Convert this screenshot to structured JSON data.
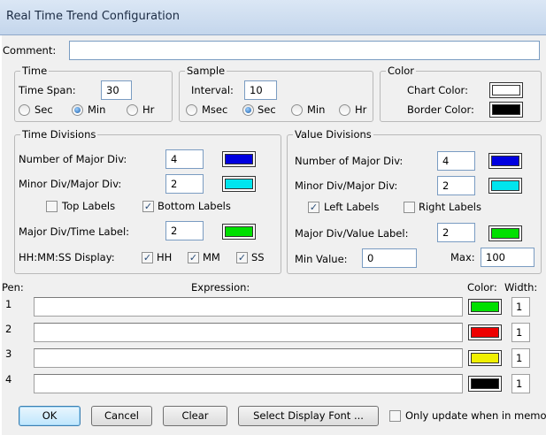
{
  "window": {
    "title": "Real Time Trend Configuration"
  },
  "comment": {
    "label": "Comment:",
    "value": ""
  },
  "time": {
    "legend": "Time",
    "span_label": "Time Span:",
    "span_value": "30",
    "units": [
      {
        "label": "Sec",
        "selected": false
      },
      {
        "label": "Min",
        "selected": true
      },
      {
        "label": "Hr",
        "selected": false
      }
    ]
  },
  "sample": {
    "legend": "Sample",
    "interval_label": "Interval:",
    "interval_value": "10",
    "units": [
      {
        "label": "Msec",
        "selected": false
      },
      {
        "label": "Sec",
        "selected": true
      },
      {
        "label": "Min",
        "selected": false
      },
      {
        "label": "Hr",
        "selected": false
      }
    ]
  },
  "color": {
    "legend": "Color",
    "chart_label": "Chart Color:",
    "chart_color": "#ffffff",
    "border_label": "Border Color:",
    "border_color": "#000000"
  },
  "time_div": {
    "legend": "Time Divisions",
    "major_label": "Number of Major Div:",
    "major_value": "4",
    "major_color": "#0000e0",
    "minor_label": "Minor Div/Major Div:",
    "minor_value": "2",
    "minor_color": "#00e5ee",
    "top_labels": "Top Labels",
    "top_checked": false,
    "bottom_labels": "Bottom Labels",
    "bottom_checked": true,
    "label_div_label": "Major Div/Time Label:",
    "label_div_value": "2",
    "label_color": "#00e000",
    "hms_label": "HH:MM:SS Display:",
    "hh": "HH",
    "mm": "MM",
    "ss": "SS"
  },
  "value_div": {
    "legend": "Value Divisions",
    "major_label": "Number of Major Div:",
    "major_value": "4",
    "major_color": "#0000e0",
    "minor_label": "Minor Div/Major Div:",
    "minor_value": "2",
    "minor_color": "#00e5ee",
    "left_labels": "Left Labels",
    "left_checked": true,
    "right_labels": "Right Labels",
    "right_checked": false,
    "label_div_label": "Major Div/Value Label:",
    "label_div_value": "2",
    "label_color": "#00e000",
    "min_label": "Min Value:",
    "min_value": "0",
    "max_label": "Max:",
    "max_value": "100"
  },
  "pens": {
    "pen_header": "Pen:",
    "expr_header": "Expression:",
    "color_header": "Color:",
    "width_header": "Width:",
    "rows": [
      {
        "num": "1",
        "expr": "",
        "color": "#00e000",
        "width": "1"
      },
      {
        "num": "2",
        "expr": "",
        "color": "#ee0000",
        "width": "1"
      },
      {
        "num": "3",
        "expr": "",
        "color": "#f0f000",
        "width": "1"
      },
      {
        "num": "4",
        "expr": "",
        "color": "#000000",
        "width": "1"
      }
    ]
  },
  "buttons": {
    "ok": "OK",
    "cancel": "Cancel",
    "clear": "Clear",
    "font": "Select Display Font ...",
    "only_update": "Only update when in memory"
  }
}
